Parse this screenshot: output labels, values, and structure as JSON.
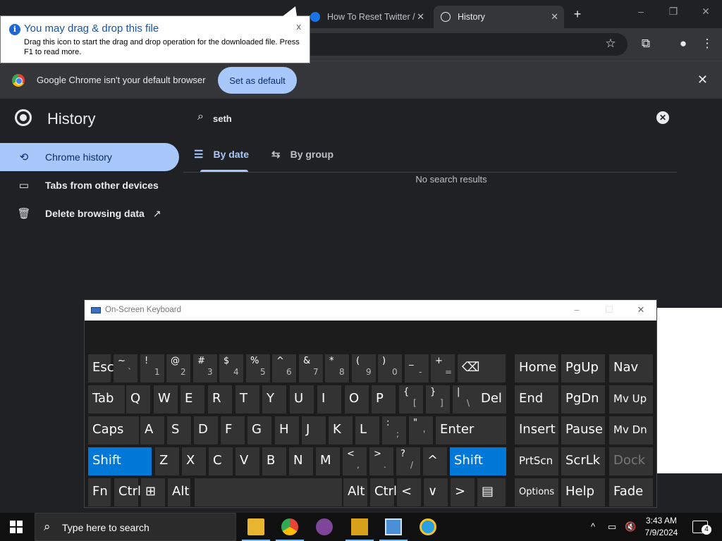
{
  "browser": {
    "tabs": [
      {
        "label": "How To Reset Twitter /",
        "state": "inactive"
      },
      {
        "label": "History",
        "state": "active"
      }
    ],
    "new_tab_icon": "plus-icon",
    "window_controls": [
      "minimize",
      "restore",
      "close"
    ]
  },
  "tooltip": {
    "title": "You may drag & drop this file",
    "body": "Drag this icon to start the drag and drop operation for the downloaded file. Press F1 to read more.",
    "close": "x"
  },
  "infobar": {
    "message": "Google Chrome isn't your default browser",
    "button": "Set as default",
    "close": "✕"
  },
  "history": {
    "title": "History",
    "search_value": "seth",
    "nav": [
      {
        "label": "Chrome history",
        "icon": "history-icon",
        "active": true
      },
      {
        "label": "Tabs from other devices",
        "icon": "devices-icon",
        "active": false
      },
      {
        "label": "Delete browsing data",
        "icon": "trash-icon",
        "active": false
      }
    ],
    "tabs": [
      {
        "label": "By date",
        "icon": "list-icon",
        "active": true
      },
      {
        "label": "By group",
        "icon": "group-icon",
        "active": false
      }
    ],
    "empty_message": "No search results"
  },
  "osk": {
    "title": "On-Screen Keyboard",
    "rows": {
      "r1": [
        {
          "m": "Esc"
        },
        {
          "up": "~",
          "lo": "`"
        },
        {
          "up": "!",
          "lo": "1"
        },
        {
          "up": "@",
          "lo": "2"
        },
        {
          "up": "#",
          "lo": "3"
        },
        {
          "up": "$",
          "lo": "4"
        },
        {
          "up": "%",
          "lo": "5"
        },
        {
          "up": "^",
          "lo": "6"
        },
        {
          "up": "&",
          "lo": "7"
        },
        {
          "up": "*",
          "lo": "8"
        },
        {
          "up": "(",
          "lo": "9"
        },
        {
          "up": ")",
          "lo": "0"
        },
        {
          "up": "_",
          "lo": "-"
        },
        {
          "up": "+",
          "lo": "="
        },
        {
          "m": "⌫"
        }
      ],
      "r2": [
        {
          "m": "Tab"
        },
        {
          "m": "Q"
        },
        {
          "m": "W"
        },
        {
          "m": "E"
        },
        {
          "m": "R"
        },
        {
          "m": "T"
        },
        {
          "m": "Y"
        },
        {
          "m": "U"
        },
        {
          "m": "I"
        },
        {
          "m": "O"
        },
        {
          "m": "P"
        },
        {
          "up": "{",
          "lo": "["
        },
        {
          "up": "}",
          "lo": "]"
        },
        {
          "up": "|",
          "lo": "\\"
        },
        {
          "m": "Del"
        }
      ],
      "r3": [
        {
          "m": "Caps"
        },
        {
          "m": "A"
        },
        {
          "m": "S"
        },
        {
          "m": "D"
        },
        {
          "m": "F"
        },
        {
          "m": "G"
        },
        {
          "m": "H"
        },
        {
          "m": "J"
        },
        {
          "m": "K"
        },
        {
          "m": "L"
        },
        {
          "up": ":",
          "lo": ";"
        },
        {
          "up": "\"",
          "lo": "'"
        },
        {
          "m": "Enter"
        }
      ],
      "r4": [
        {
          "m": "Shift"
        },
        {
          "m": "Z"
        },
        {
          "m": "X"
        },
        {
          "m": "C"
        },
        {
          "m": "V"
        },
        {
          "m": "B"
        },
        {
          "m": "N"
        },
        {
          "m": "M"
        },
        {
          "up": "<",
          "lo": ","
        },
        {
          "up": ">",
          "lo": "."
        },
        {
          "up": "?",
          "lo": "/"
        },
        {
          "m": "^"
        },
        {
          "m": "Shift"
        }
      ],
      "r5": [
        {
          "m": "Fn"
        },
        {
          "m": "Ctrl"
        },
        {
          "m": "⊞"
        },
        {
          "m": "Alt"
        },
        {
          "m": ""
        },
        {
          "m": "Alt"
        },
        {
          "m": "Ctrl"
        },
        {
          "m": "<"
        },
        {
          "m": "∨"
        },
        {
          "m": ">"
        },
        {
          "m": "▤"
        }
      ],
      "nav1": [
        {
          "m": "Home"
        },
        {
          "m": "PgUp"
        },
        {
          "m": "Nav"
        }
      ],
      "nav2": [
        {
          "m": "End"
        },
        {
          "m": "PgDn"
        },
        {
          "m": "Mv Up"
        }
      ],
      "nav3": [
        {
          "m": "Insert"
        },
        {
          "m": "Pause"
        },
        {
          "m": "Mv Dn"
        }
      ],
      "nav4": [
        {
          "m": "PrtScn"
        },
        {
          "m": "ScrLk"
        },
        {
          "m": "Dock"
        }
      ],
      "nav5": [
        {
          "m": "Options"
        },
        {
          "m": "Help"
        },
        {
          "m": "Fade"
        }
      ]
    }
  },
  "taskbar": {
    "search_placeholder": "Type here to search",
    "apps": [
      "file-explorer-icon",
      "chrome-icon",
      "tor-browser-icon",
      "tool-app-icon",
      "remote-desktop-icon",
      "ie-icon"
    ],
    "time": "3:43 AM",
    "date": "7/9/2024",
    "notifications_count": "4"
  },
  "colors": {
    "accent": "#a8c7fa",
    "osk_highlight": "#0078d7",
    "background": "#202124"
  }
}
